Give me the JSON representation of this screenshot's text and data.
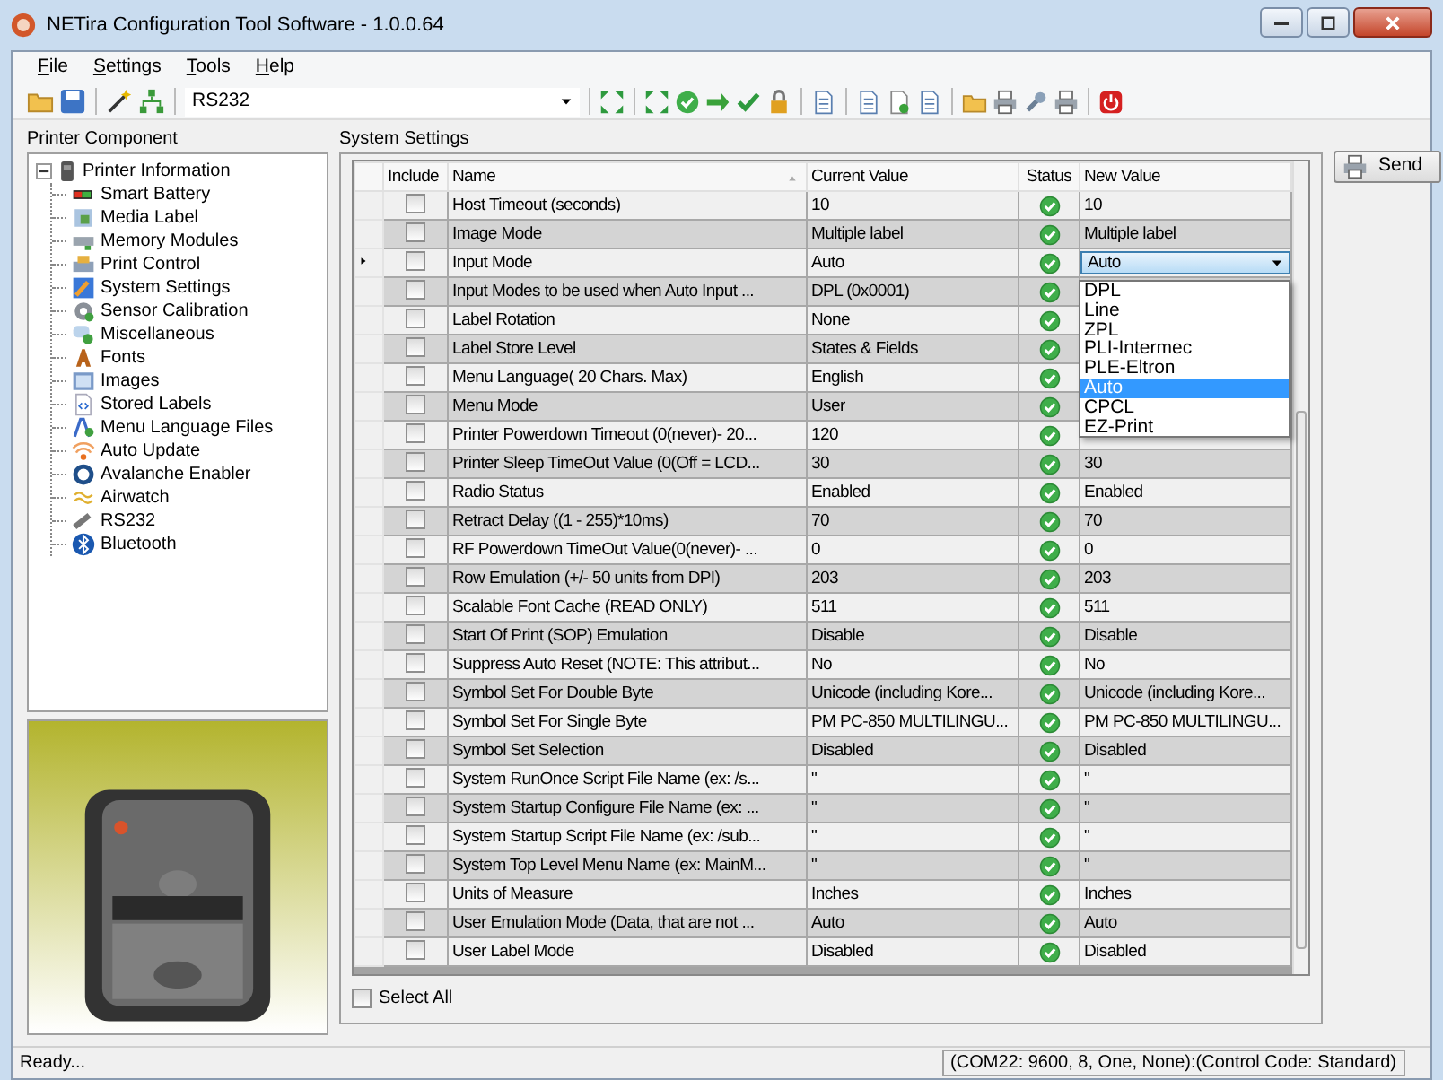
{
  "window": {
    "title": "NETira Configuration Tool Software - 1.0.0.64"
  },
  "menu": [
    "File",
    "Settings",
    "Tools",
    "Help"
  ],
  "toolbar": {
    "port": "RS232"
  },
  "left_panel": {
    "title": "Printer Component",
    "tree": [
      {
        "label": "Printer Information",
        "expanded": true,
        "children": [
          {
            "label": "Smart Battery"
          },
          {
            "label": "Media Label"
          },
          {
            "label": "Memory Modules"
          },
          {
            "label": "Print Control"
          },
          {
            "label": "System Settings"
          },
          {
            "label": "Sensor Calibration"
          },
          {
            "label": "Miscellaneous"
          },
          {
            "label": "Fonts"
          },
          {
            "label": "Images"
          },
          {
            "label": "Stored Labels"
          },
          {
            "label": "Menu Language Files"
          },
          {
            "label": "Auto Update"
          },
          {
            "label": "Avalanche Enabler"
          },
          {
            "label": "Airwatch"
          },
          {
            "label": "RS232"
          },
          {
            "label": "Bluetooth"
          }
        ]
      }
    ]
  },
  "settings": {
    "title": "System Settings",
    "columns": [
      "Include",
      "Name",
      "Current Value",
      "Status",
      "New Value"
    ],
    "rows": [
      {
        "name": "Host Timeout (seconds)",
        "current": "10",
        "ok": true,
        "new": "10",
        "checked": false,
        "current_row": false
      },
      {
        "name": "Image Mode",
        "current": "Multiple label",
        "ok": true,
        "new": "Multiple label",
        "checked": false,
        "current_row": false
      },
      {
        "name": "Input Mode",
        "current": "Auto",
        "ok": true,
        "checked": false,
        "current_row": true,
        "editing": true
      },
      {
        "name": "Input Modes to be used when Auto Input ...",
        "current": "DPL (0x0001)",
        "ok": true,
        "checked": false,
        "current_row": false
      },
      {
        "name": "Label Rotation",
        "current": "None",
        "ok": true,
        "checked": false,
        "current_row": false
      },
      {
        "name": "Label Store Level",
        "current": "States & Fields",
        "ok": true,
        "checked": false,
        "current_row": false
      },
      {
        "name": "Menu Language( 20 Chars. Max)",
        "current": "English",
        "ok": true,
        "checked": false,
        "current_row": false
      },
      {
        "name": "Menu Mode",
        "current": "User",
        "ok": true,
        "checked": false,
        "current_row": false
      },
      {
        "name": "Printer Powerdown Timeout (0(never)- 20...",
        "current": "120",
        "ok": true,
        "checked": false,
        "current_row": false
      },
      {
        "name": "Printer Sleep TimeOut Value (0(Off = LCD...",
        "current": "30",
        "ok": true,
        "new": "30",
        "checked": false,
        "current_row": false
      },
      {
        "name": "Radio Status",
        "current": "Enabled",
        "ok": true,
        "new": "Enabled",
        "checked": false,
        "current_row": false
      },
      {
        "name": "Retract Delay ((1 - 255)*10ms)",
        "current": "70",
        "ok": true,
        "new": "70",
        "checked": false,
        "current_row": false
      },
      {
        "name": "RF Powerdown TimeOut Value(0(never)- ...",
        "current": "0",
        "ok": true,
        "new": "0",
        "checked": false,
        "current_row": false
      },
      {
        "name": "Row Emulation (+/- 50 units from DPI)",
        "current": "203",
        "ok": true,
        "new": "203",
        "checked": false,
        "current_row": false
      },
      {
        "name": "Scalable Font Cache (READ ONLY)",
        "current": "511",
        "ok": true,
        "new": "511",
        "checked": false,
        "current_row": false
      },
      {
        "name": "Start Of Print (SOP) Emulation",
        "current": "Disable",
        "ok": true,
        "new": "Disable",
        "checked": false,
        "current_row": false
      },
      {
        "name": "Suppress Auto Reset (NOTE: This attribut...",
        "current": "No",
        "ok": true,
        "new": "No",
        "checked": false,
        "current_row": false
      },
      {
        "name": "Symbol Set For Double Byte",
        "current": "Unicode (including Kore...",
        "ok": true,
        "new": "Unicode (including Kore...",
        "checked": false,
        "current_row": false
      },
      {
        "name": "Symbol Set For Single Byte",
        "current": "PM PC-850 MULTILINGU...",
        "ok": true,
        "new": "PM PC-850 MULTILINGU...",
        "checked": false,
        "current_row": false
      },
      {
        "name": "Symbol Set Selection",
        "current": "Disabled",
        "ok": true,
        "new": "Disabled",
        "checked": false,
        "current_row": false
      },
      {
        "name": "System RunOnce Script File Name (ex: /s...",
        "current": "\"",
        "ok": true,
        "new": "\"",
        "checked": false,
        "current_row": false
      },
      {
        "name": "System Startup Configure File Name (ex: ...",
        "current": "\"",
        "ok": true,
        "new": "\"",
        "checked": false,
        "current_row": false
      },
      {
        "name": "System Startup Script File Name (ex: /sub...",
        "current": "\"",
        "ok": true,
        "new": "\"",
        "checked": false,
        "current_row": false
      },
      {
        "name": "System Top Level Menu Name (ex: MainM...",
        "current": "\"",
        "ok": true,
        "new": "\"",
        "checked": false,
        "current_row": false
      },
      {
        "name": "Units of Measure",
        "current": "Inches",
        "ok": true,
        "new": "Inches",
        "checked": false,
        "current_row": false
      },
      {
        "name": "User Emulation Mode (Data, that are not ...",
        "current": "Auto",
        "ok": true,
        "new": "Auto",
        "checked": false,
        "current_row": false
      },
      {
        "name": "User Label Mode",
        "current": "Disabled",
        "ok": true,
        "new": "Disabled",
        "checked": false,
        "current_row": false
      }
    ],
    "dropdown": {
      "value": "Auto",
      "options": [
        {
          "label": "DPL",
          "selected": false
        },
        {
          "label": "Line",
          "selected": false
        },
        {
          "label": "ZPL",
          "selected": false
        },
        {
          "label": "PLI-Intermec",
          "selected": false
        },
        {
          "label": "PLE-Eltron",
          "selected": false
        },
        {
          "label": "Auto",
          "selected": true
        },
        {
          "label": "CPCL",
          "selected": false
        },
        {
          "label": "EZ-Print",
          "selected": false
        }
      ]
    },
    "select_all": {
      "label": "Select All",
      "checked": false
    }
  },
  "send_button": "Send",
  "status_bar": {
    "left": "Ready...",
    "right": "(COM22: 9600, 8, One, None):(Control Code: Standard)"
  }
}
